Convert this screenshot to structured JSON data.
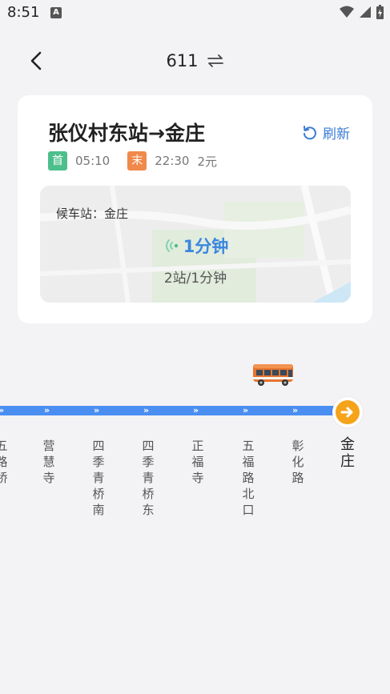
{
  "status_bar": {
    "time": "8:51",
    "a_icon_letter": "A"
  },
  "header": {
    "route_number": "611",
    "swap_icon": "swap-direction-icon",
    "back_icon": "chevron-left-icon"
  },
  "info": {
    "direction": "张仪村东站→金庄",
    "refresh_label": "刷新",
    "first_badge": "首",
    "first_time": "05:10",
    "last_badge": "末",
    "last_time": "22:30",
    "fare": "2元",
    "waiting_label": "候车站：金庄",
    "arrival": "1分钟",
    "arrival_detail": "2站/1分钟"
  },
  "stations": [
    {
      "name": "五\n路\n桥",
      "current": false
    },
    {
      "name": "营\n慧\n寺",
      "current": false
    },
    {
      "name": "四\n季\n青\n桥\n南",
      "current": false
    },
    {
      "name": "四\n季\n青\n桥\n东",
      "current": false
    },
    {
      "name": "正\n福\n寺",
      "current": false
    },
    {
      "name": "五\n福\n路\n北\n口",
      "current": false
    },
    {
      "name": "彰\n化\n路",
      "current": false
    },
    {
      "name": "金\n庄",
      "current": true
    }
  ],
  "colors": {
    "accent": "#3a86e0",
    "route_line": "#4a8ef2",
    "first_badge": "#4cbf8c",
    "last_badge": "#f0894b",
    "destination": "#f5a31a"
  }
}
